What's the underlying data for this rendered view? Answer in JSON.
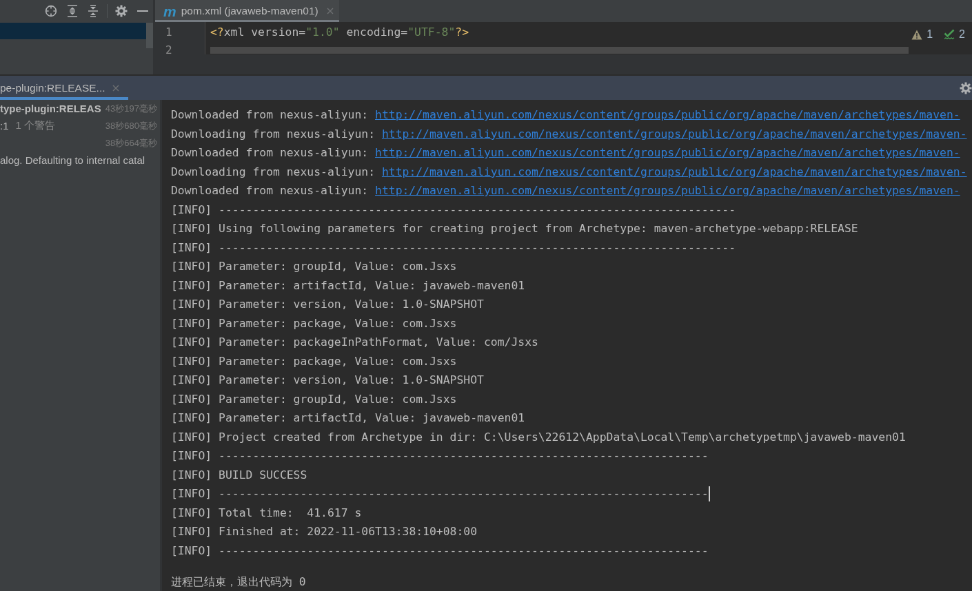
{
  "editor": {
    "tabs": [
      {
        "icon": "m",
        "label": "pom.xml (javaweb-maven01)",
        "selected": true
      }
    ],
    "line_numbers": [
      "1",
      "2"
    ],
    "code_lines": [
      {
        "tokens": [
          {
            "text": "<?",
            "kind": "bracket"
          },
          {
            "text": "xml version=",
            "kind": "attribute"
          },
          {
            "text": "\"1.0\"",
            "kind": "value"
          },
          {
            "text": " encoding=",
            "kind": "attribute"
          },
          {
            "text": "\"UTF-8\"",
            "kind": "value"
          },
          {
            "text": "?>",
            "kind": "bracket"
          }
        ]
      }
    ],
    "inspections": [
      {
        "kind": "warning",
        "count": "1"
      },
      {
        "kind": "check",
        "count": "2"
      }
    ]
  },
  "run_panel": {
    "tabs": [
      {
        "label": "pe-plugin:RELEASE...",
        "selected": true
      }
    ],
    "tree": [
      {
        "kind": "root",
        "label": "type-plugin:RELEAS",
        "time": "43秒197毫秒"
      },
      {
        "kind": "item",
        "label": ":1",
        "note": "1 个警告",
        "time": "38秒680毫秒"
      },
      {
        "kind": "item",
        "time": "38秒664毫秒"
      },
      {
        "kind": "message",
        "label": "alog. Defaulting to internal catal"
      }
    ],
    "console": {
      "lines": [
        {
          "kind": "download",
          "prefix": "Downloaded from nexus-aliyun:",
          "url": "http://maven.aliyun.com/nexus/content/groups/public/org/apache/maven/archetypes/maven-",
          "caret": false
        },
        {
          "kind": "download",
          "prefix": "Downloading from nexus-aliyun:",
          "url": "http://maven.aliyun.com/nexus/content/groups/public/org/apache/maven/archetypes/maven-",
          "caret": false
        },
        {
          "kind": "download",
          "prefix": "Downloaded from nexus-aliyun:",
          "url": "http://maven.aliyun.com/nexus/content/groups/public/org/apache/maven/archetypes/maven-",
          "caret": false
        },
        {
          "kind": "download",
          "prefix": "Downloading from nexus-aliyun:",
          "url": "http://maven.aliyun.com/nexus/content/groups/public/org/apache/maven/archetypes/maven-",
          "caret": false
        },
        {
          "kind": "download",
          "prefix": "Downloaded from nexus-aliyun:",
          "url": "http://maven.aliyun.com/nexus/content/groups/public/org/apache/maven/archetypes/maven-",
          "caret": false
        },
        {
          "kind": "log",
          "text": "[INFO] ----------------------------------------------------------------------------",
          "caret": false
        },
        {
          "kind": "log",
          "text": "[INFO] Using following parameters for creating project from Archetype: maven-archetype-webapp:RELEASE",
          "caret": false
        },
        {
          "kind": "log",
          "text": "[INFO] ----------------------------------------------------------------------------",
          "caret": false
        },
        {
          "kind": "log",
          "text": "[INFO] Parameter: groupId, Value: com.Jsxs",
          "caret": false
        },
        {
          "kind": "log",
          "text": "[INFO] Parameter: artifactId, Value: javaweb-maven01",
          "caret": false
        },
        {
          "kind": "log",
          "text": "[INFO] Parameter: version, Value: 1.0-SNAPSHOT",
          "caret": false
        },
        {
          "kind": "log",
          "text": "[INFO] Parameter: package, Value: com.Jsxs",
          "caret": false
        },
        {
          "kind": "log",
          "text": "[INFO] Parameter: packageInPathFormat, Value: com/Jsxs",
          "caret": false
        },
        {
          "kind": "log",
          "text": "[INFO] Parameter: package, Value: com.Jsxs",
          "caret": false
        },
        {
          "kind": "log",
          "text": "[INFO] Parameter: version, Value: 1.0-SNAPSHOT",
          "caret": false
        },
        {
          "kind": "log",
          "text": "[INFO] Parameter: groupId, Value: com.Jsxs",
          "caret": false
        },
        {
          "kind": "log",
          "text": "[INFO] Parameter: artifactId, Value: javaweb-maven01",
          "caret": false
        },
        {
          "kind": "log",
          "text": "[INFO] Project created from Archetype in dir: C:\\Users\\22612\\AppData\\Local\\Temp\\archetypetmp\\javaweb-maven01",
          "caret": false
        },
        {
          "kind": "log",
          "text": "[INFO] ------------------------------------------------------------------------",
          "caret": false
        },
        {
          "kind": "log",
          "text": "[INFO] BUILD SUCCESS",
          "caret": false
        },
        {
          "kind": "log",
          "text": "[INFO] ------------------------------------------------------------------------",
          "caret": true
        },
        {
          "kind": "log",
          "text": "[INFO] Total time:  41.617 s",
          "caret": false
        },
        {
          "kind": "log",
          "text": "[INFO] Finished at: 2022-11-06T13:38:10+08:00",
          "caret": false
        },
        {
          "kind": "log",
          "text": "[INFO] ------------------------------------------------------------------------",
          "caret": false
        },
        {
          "kind": "exit",
          "text": "进程已结束，退出代码为 0",
          "caret": false
        }
      ]
    }
  }
}
